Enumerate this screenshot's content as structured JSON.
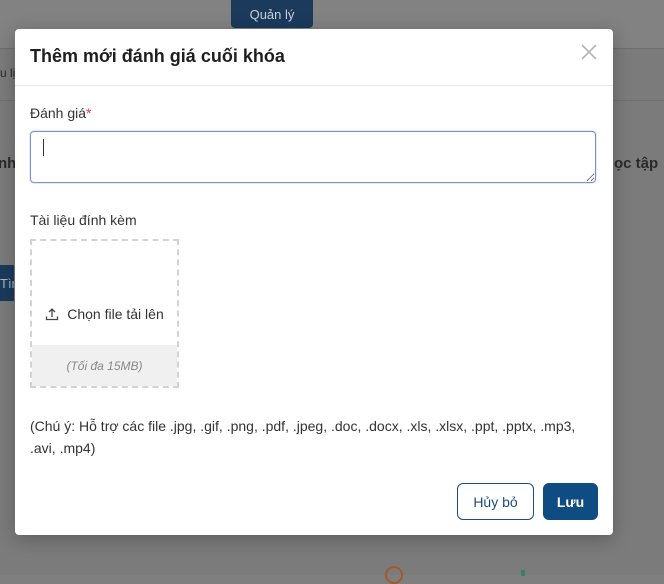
{
  "background": {
    "manage_button": "Quản lý",
    "fragment_left_1": "u lị",
    "fragment_left_2": "nh",
    "fragment_right": "ọc tập",
    "side_button": "Tìn"
  },
  "modal": {
    "title": "Thêm mới đánh giá cuối khóa",
    "review_label": "Đánh giá",
    "required_mark": "*",
    "review_value": "",
    "attachment_label": "Tài liệu đính kèm",
    "upload_label": "Chọn file tải lên",
    "upload_limit": "(Tối đa 15MB)",
    "note": "(Chú ý: Hỗ trợ các file .jpg, .gif, .png, .pdf, .jpeg, .doc, .docx, .xls, .xlsx, .ppt, .pptx, .mp3, .avi, .mp4)",
    "cancel_label": "Hủy bỏ",
    "save_label": "Lưu"
  },
  "colors": {
    "primary": "#0f4c81",
    "required": "#e53935",
    "focus_border": "#7a8fd8"
  },
  "icons": {
    "close": "close-icon",
    "upload": "upload-icon"
  }
}
